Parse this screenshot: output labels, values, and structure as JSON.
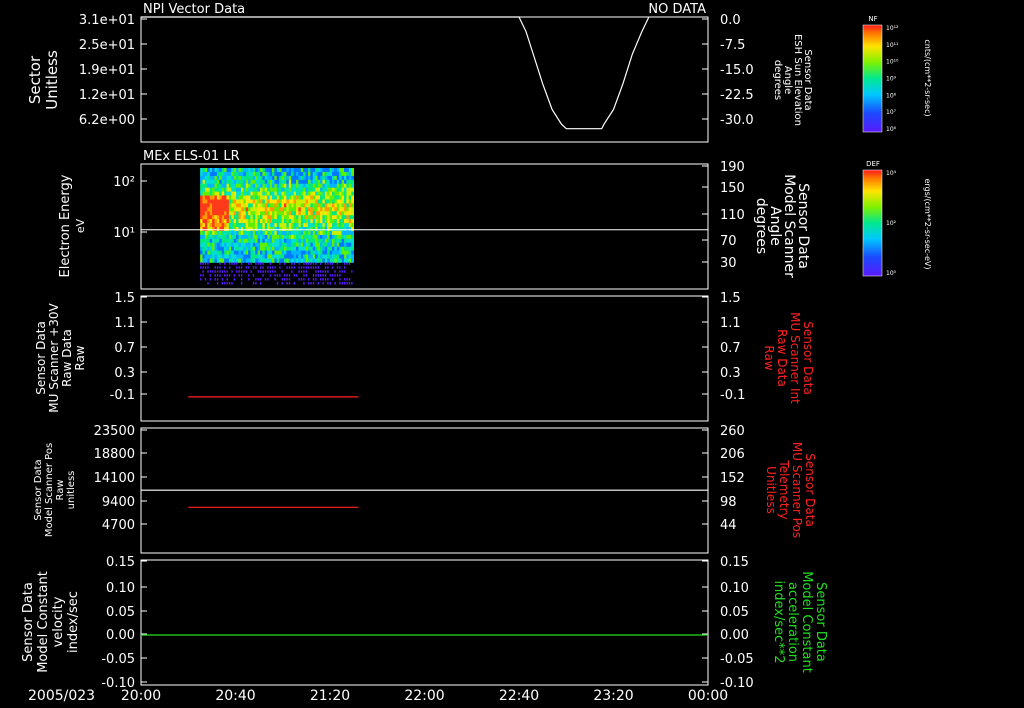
{
  "chart_data": [
    {
      "type": "line",
      "title": "NPI Vector Data",
      "status": "NO DATA",
      "ylabel_left": [
        "Sector",
        "Unitless"
      ],
      "ylabel_right": [
        "Sensor Data",
        "ESH Sun Elevation",
        "Angle",
        "degrees"
      ],
      "left_ticks": [
        "3.1e+01",
        "2.5e+01",
        "1.9e+01",
        "1.2e+01",
        "6.2e+00"
      ],
      "right_ticks": [
        "0.0",
        "-7.5",
        "-15.0",
        "-22.5",
        "-30.0"
      ],
      "ylim_right": [
        -33.8,
        0
      ],
      "series": [
        {
          "color": "#ffffff",
          "x": [
            0,
            160,
            163,
            166,
            170,
            174,
            178,
            180,
            195,
            196,
            200,
            204,
            208,
            212,
            215
          ],
          "y": [
            0,
            0,
            -4,
            -10,
            -18,
            -25,
            -29,
            -30.2,
            -30.2,
            -29,
            -25,
            -18,
            -10,
            -4,
            0
          ]
        }
      ]
    },
    {
      "type": "heatmap",
      "title": "MEx ELS-01 LR",
      "ylabel_left": [
        "Electron Energy",
        "eV"
      ],
      "ylabel_right": [
        "Sensor Data",
        "Model Scanner",
        "Angle",
        "degrees"
      ],
      "left_ticks": [
        "10²",
        "10¹"
      ],
      "right_ticks": [
        "190",
        "150",
        "110",
        "70",
        "30"
      ],
      "ylim_right": [
        0,
        190
      ],
      "x_range": [
        25,
        90
      ],
      "overlay_line": {
        "color": "#ffffff",
        "value": 90
      }
    },
    {
      "type": "line",
      "ylabel_left": [
        "Sensor Data",
        "MU Scanner +30V",
        "Raw Data",
        "Raw"
      ],
      "ylabel_right": [
        "Sensor Data",
        "MU Scanner Int",
        "Raw Data",
        "Raw"
      ],
      "ylabel_right_color": "#ff2020",
      "left_ticks": [
        "1.5",
        "1.1",
        "0.7",
        "0.3",
        "-0.1"
      ],
      "right_ticks": [
        "1.5",
        "1.1",
        "0.7",
        "0.3",
        "-0.1"
      ],
      "ylim": [
        -0.42,
        1.5
      ],
      "series": [
        {
          "color": "#ff2020",
          "x": [
            20,
            92
          ],
          "y": [
            -0.05,
            -0.05
          ]
        }
      ]
    },
    {
      "type": "line",
      "ylabel_left": [
        "Sensor Data",
        "Model Scanner Pos",
        "Raw",
        "unitless"
      ],
      "ylabel_right": [
        "Sensor Data",
        "MU Scanner Pos",
        "Telemetry",
        "Unitless"
      ],
      "ylabel_right_color": "#ff2020",
      "left_ticks": [
        "23500",
        "18800",
        "14100",
        "9400",
        "4700"
      ],
      "right_ticks": [
        "260",
        "206",
        "152",
        "98",
        "44"
      ],
      "ylim_left": [
        0,
        23500
      ],
      "series": [
        {
          "color": "#ff2020",
          "x": [
            20,
            92
          ],
          "y": [
            8600,
            8600
          ]
        },
        {
          "color": "#ffffff",
          "x": [
            0,
            240
          ],
          "y": [
            11800,
            11800
          ]
        }
      ]
    },
    {
      "type": "line",
      "ylabel_left": [
        "Sensor Data",
        "Model Constant",
        "velocity",
        "index/sec"
      ],
      "ylabel_right": [
        "Sensor Data",
        "Model Constant",
        "acceleration",
        "index/sec**2"
      ],
      "ylabel_right_color": "#22dd22",
      "left_ticks": [
        "0.15",
        "0.10",
        "0.05",
        "0.00",
        "-0.05",
        "-0.10"
      ],
      "right_ticks": [
        "0.15",
        "0.10",
        "0.05",
        "0.00",
        "-0.05",
        "-0.10"
      ],
      "ylim": [
        -0.1,
        0.15
      ],
      "series": [
        {
          "color": "#22dd22",
          "x": [
            0,
            240
          ],
          "y": [
            0,
            0
          ]
        }
      ]
    }
  ],
  "time_axis": {
    "date_label": "2005/023",
    "ticks": [
      "20:00",
      "20:40",
      "21:20",
      "22:00",
      "22:40",
      "23:20",
      "00:00"
    ],
    "minutes_span": 240
  },
  "colorbars": [
    {
      "label": "NF",
      "unit": "cnts/(cm**2-sr-sec)",
      "ticks": [
        "10¹²",
        "10¹¹",
        "10¹⁰",
        "10⁹",
        "10⁸",
        "10⁷",
        "10⁶"
      ]
    },
    {
      "label": "DEF",
      "unit": "ergs/(cm**2-sr-sec-eV)",
      "ticks": [
        "10⁴",
        "10²",
        "10⁰"
      ]
    }
  ]
}
